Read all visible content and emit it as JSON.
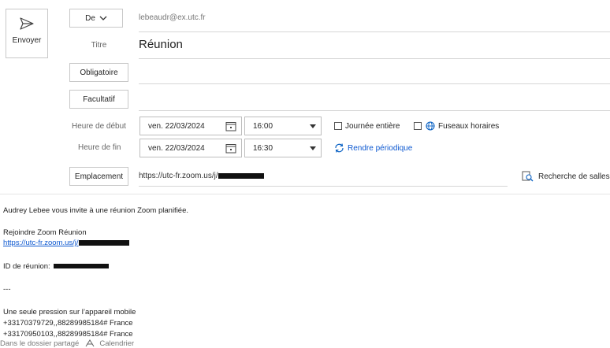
{
  "toolbar": {
    "send_label": "Envoyer"
  },
  "header": {
    "from_button": "De",
    "from_address": "lebeaudr@ex.utc.fr",
    "title_label": "Titre",
    "title_value": "Réunion",
    "required_button": "Obligatoire",
    "optional_button": "Facultatif",
    "start_label": "Heure de début",
    "start_date": "ven. 22/03/2024",
    "start_time": "16:00",
    "end_label": "Heure de fin",
    "end_date": "ven. 22/03/2024",
    "end_time": "16:30",
    "all_day_label": "Journée entière",
    "timezones_label": "Fuseaux horaires",
    "recurring_label": "Rendre périodique",
    "location_button": "Emplacement",
    "location_value": "https://utc-fr.zoom.us/j/",
    "room_search_label": "Recherche de salles"
  },
  "body": {
    "line1": "Audrey Lebee vous invite à une réunion Zoom planifiée.",
    "join_label": "Rejoindre Zoom Réunion",
    "join_link": "https://utc-fr.zoom.us/j/",
    "meeting_id_label": "ID de réunion:",
    "separator": "---",
    "mobile_label": "Une seule pression sur l’appareil mobile",
    "phone1": "+33170379729,,88289985184# France",
    "phone2": "+33170950103,,88289985184# France"
  },
  "footer": {
    "shared_folder_label": "Dans le dossier partagé",
    "calendar_label": "Calendrier"
  }
}
